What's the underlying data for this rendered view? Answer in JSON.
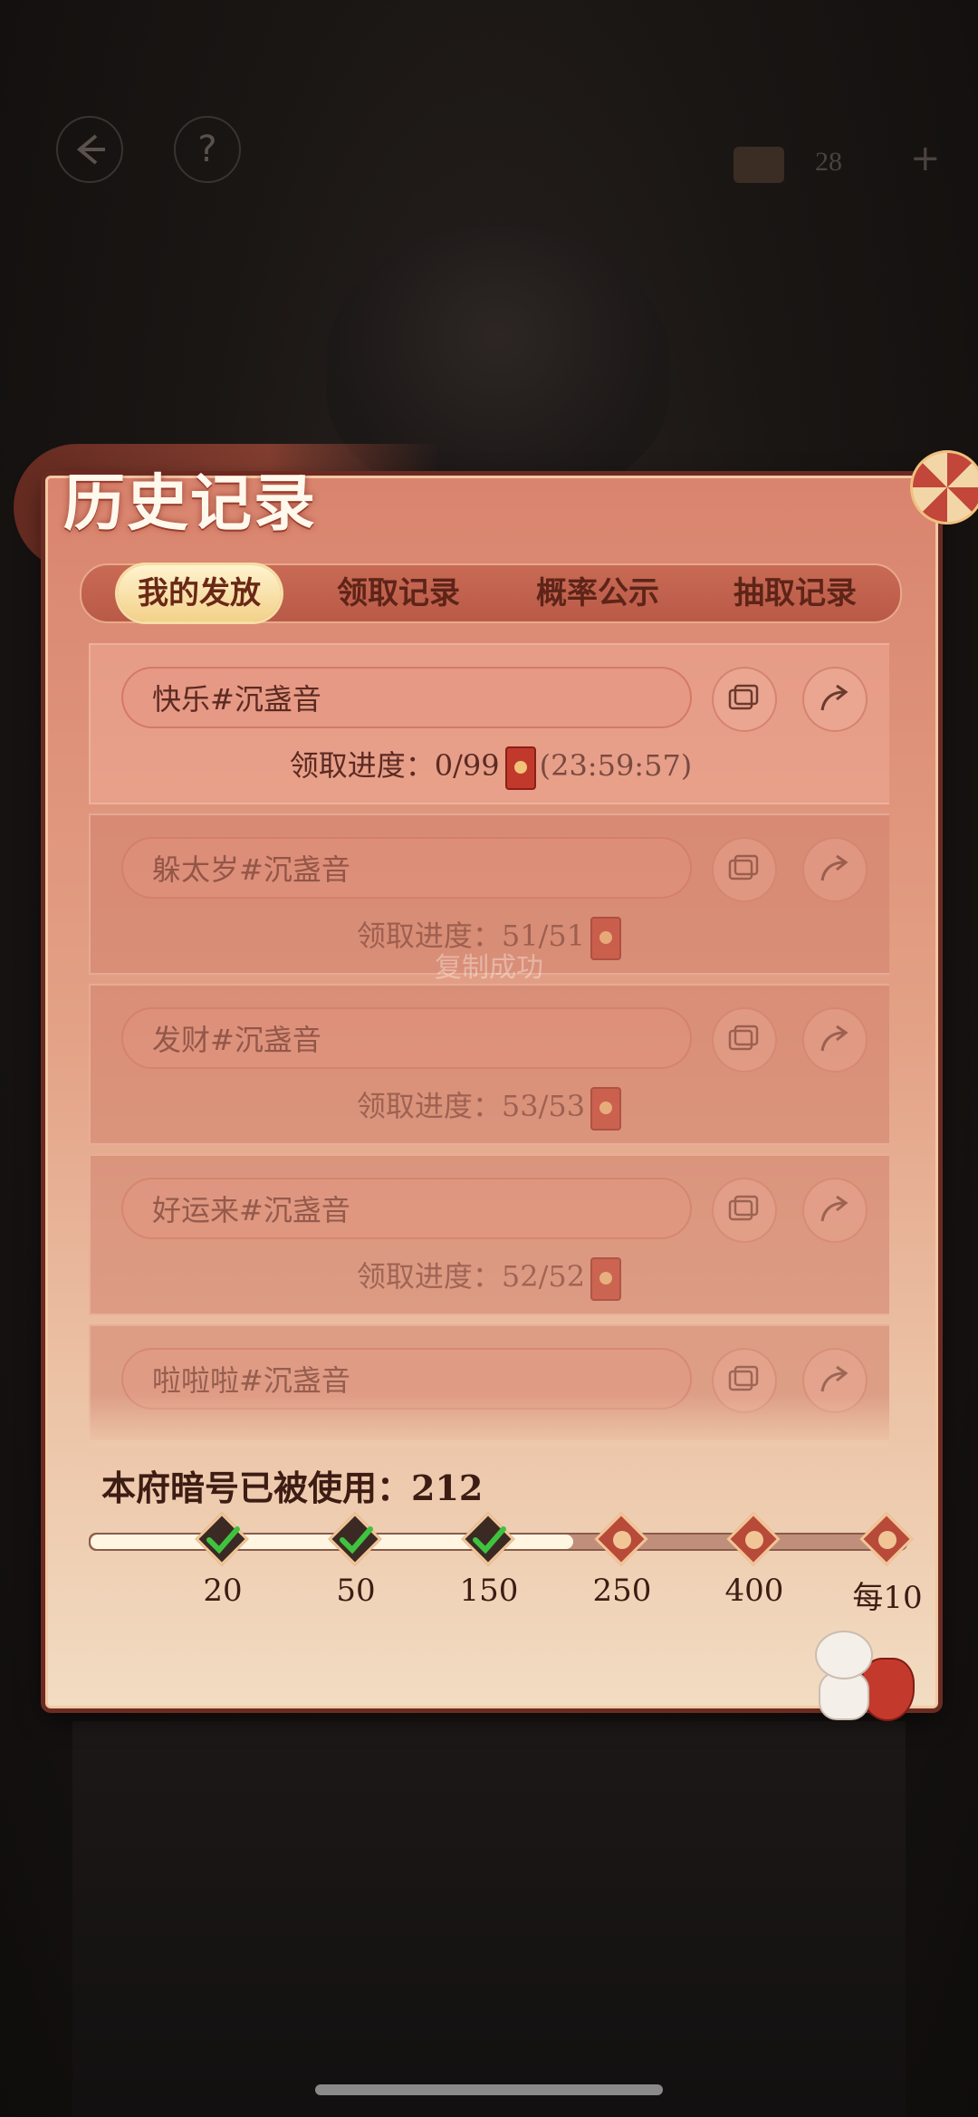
{
  "top": {
    "back_icon": "back-arrow-icon",
    "help_label": "?",
    "currency_value": "28",
    "add_label": "+"
  },
  "panel": {
    "title": "历史记录"
  },
  "tabs": [
    {
      "label": "我的发放",
      "active": true
    },
    {
      "label": "领取记录",
      "active": false
    },
    {
      "label": "概率公示",
      "active": false
    },
    {
      "label": "抽取记录",
      "active": false
    }
  ],
  "records": [
    {
      "code": "快乐#沉盏音",
      "progress_label": "领取进度：",
      "progress": "0/99",
      "timer": "(23:59:57)"
    },
    {
      "code": "躲太岁#沉盏音",
      "progress_label": "领取进度：",
      "progress": "51/51"
    },
    {
      "code": "发财#沉盏音",
      "progress_label": "领取进度：",
      "progress": "53/53"
    },
    {
      "code": "好运来#沉盏音",
      "progress_label": "领取进度：",
      "progress": "52/52"
    },
    {
      "code": "啦啦啦#沉盏音"
    }
  ],
  "toast": "复制成功",
  "usage": {
    "label": "本府暗号已被使用：212",
    "used": 212,
    "milestones": [
      {
        "label": "20",
        "done": true
      },
      {
        "label": "50",
        "done": true
      },
      {
        "label": "150",
        "done": true
      },
      {
        "label": "250",
        "done": false
      },
      {
        "label": "400",
        "done": false
      },
      {
        "label": "每10",
        "done": false
      }
    ]
  },
  "colors": {
    "panel_top": "#d9846e",
    "panel_bottom": "#f2dcc2",
    "accent_red": "#c0392b",
    "text_dark": "#5b2a22"
  }
}
